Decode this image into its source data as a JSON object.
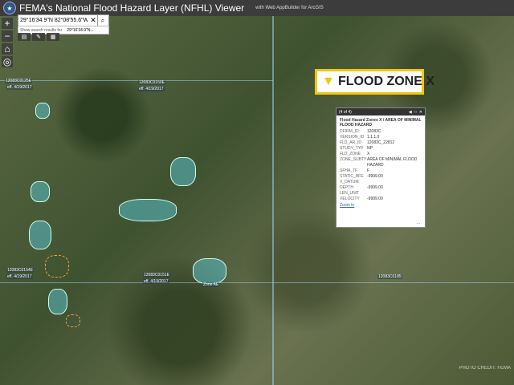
{
  "header": {
    "logo": "fema-logo",
    "title": "FEMA's National Flood Hazard Layer (NFHL) Viewer",
    "subtitle": "with Web AppBuilder for ArcGIS"
  },
  "zoom": {
    "in": "+",
    "out": "−"
  },
  "search": {
    "value": "29°16'34.9\"N 82°08'55.6\"W",
    "suggestion_prefix": "Show search results for",
    "suggestion_value": "29°16'34.9\"N..."
  },
  "flood_zone": {
    "label": "FLOOD ZONE X",
    "pin": "location-pin-icon",
    "accent": "#f2c800"
  },
  "popup": {
    "counter": "(4 of 4)",
    "title": "Flood Hazard Zones X / AREA OF MINIMAL FLOOD HAZARD",
    "rows": [
      {
        "k": "DFIRM_ID",
        "v": "12083C"
      },
      {
        "k": "VERSION_ID",
        "v": "1.1.1.0"
      },
      {
        "k": "FLD_AR_ID",
        "v": "12083C_22812"
      },
      {
        "k": "STUDY_TYP",
        "v": "NP"
      },
      {
        "k": "FLD_ZONE",
        "v": "X"
      },
      {
        "k": "ZONE_SUBTY",
        "v": "AREA OF MINIMAL FLOOD HAZARD"
      },
      {
        "k": "SFHA_TF",
        "v": "F"
      },
      {
        "k": "STATIC_BFE",
        "v": "-9999.00"
      },
      {
        "k": "V_DATUM",
        "v": ""
      },
      {
        "k": "DEPTH",
        "v": "-9999.00"
      },
      {
        "k": "LEN_UNIT",
        "v": ""
      },
      {
        "k": "VELOCITY",
        "v": "-9999.00"
      }
    ],
    "zoom_to": "Zoom to",
    "more": "..."
  },
  "map_labels": [
    "12083C0125E",
    "eff. 4/19/2017",
    "12083C0150E",
    "eff. 4/19/2017",
    "12083C0154E",
    "eff. 4/19/2017",
    "12083C0151E",
    "eff. 4/19/2017",
    "12083C0185",
    "Zone AE"
  ],
  "credit": "PHOTO CREDIT: FEMA"
}
